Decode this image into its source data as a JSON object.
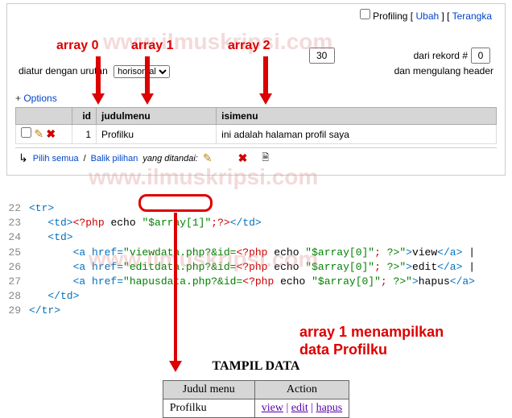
{
  "top": {
    "profiling_label": "Profiling",
    "ubah": "Ubah",
    "terangka": "Terangka",
    "num_rows": "30",
    "dari_rekord": "dari rekord #",
    "rekord_start": "0",
    "diatur": "diatur dengan urutan",
    "horisontal": "horisontal",
    "mengulang": "dan mengulang header",
    "options": "Options"
  },
  "table": {
    "cols": {
      "id": "id",
      "judul": "judulmenu",
      "isi": "isimenu"
    },
    "row": {
      "id": "1",
      "judul": "Profilku",
      "isi": "ini adalah halaman profil saya"
    }
  },
  "select_row": {
    "pilih": "Pilih semua",
    "balik": "Balik pilihan",
    "yang": "yang ditandai:"
  },
  "anno": {
    "a0": "array 0",
    "a1": "array 1",
    "a2": "array 2",
    "right_line1": "array 1 menampilkan",
    "right_line2": "data Profilku"
  },
  "watermark": "www.ilmuskripsi.com",
  "code": {
    "l22": "22",
    "l23": "23",
    "l24": "24",
    "l25": "25",
    "l26": "26",
    "l27": "27",
    "l28": "28",
    "l29": "29",
    "tr_open": "<tr>",
    "td_open": "<td>",
    "php_open": "<?php",
    "echo": " echo ",
    "arr1": "\"$array[1]\"",
    "php_close": ";?>",
    "td_close": "</td>",
    "a_href": "<a href=",
    "view_url": "\"viewdata.php?&id=",
    "edit_url": "\"editdata.php?&id=",
    "hapus_url": "\"hapusdata.php?&id=",
    "arr0": "\"$array[0]\"",
    "semi": "; ",
    "qclose": "?>\"",
    "gt": ">",
    "view": "view",
    "edit": "edit",
    "hapus": "hapus",
    "a_close": "</a>",
    "pipe": " | ",
    "tr_close": "</tr>"
  },
  "output": {
    "title": "TAMPIL DATA",
    "col1": "Judul menu",
    "col2": "Action",
    "cell1": "Profilku",
    "view": "view",
    "edit": "edit",
    "hapus": "hapus"
  }
}
